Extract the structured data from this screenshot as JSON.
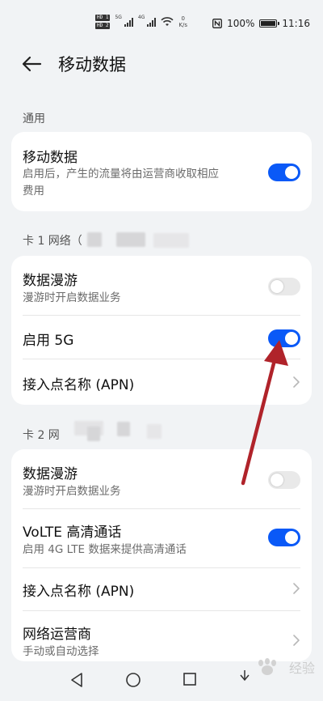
{
  "status_bar": {
    "sim1_label": "HD 1",
    "sim2_label": "HD 2",
    "net_type": "5G",
    "net_type2": "4G",
    "speed_value": "0",
    "speed_unit": "K/s",
    "battery_text": "100%",
    "battery_level": 1.0,
    "time": "11:16"
  },
  "header": {
    "title": "移动数据"
  },
  "general": {
    "section_label": "通用",
    "mobile_data": {
      "title": "移动数据",
      "subtitle_line1": "启用后，产生的流量将由运营商收取相应",
      "subtitle_line2": "费用",
      "enabled": true
    }
  },
  "sim1": {
    "section_label": "卡 1 网络（",
    "roaming": {
      "title": "数据漫游",
      "subtitle": "漫游时开启数据业务",
      "enabled": false
    },
    "enable_5g": {
      "title": "启用 5G",
      "enabled": true
    },
    "apn": {
      "title": "接入点名称 (APN)"
    }
  },
  "sim2": {
    "section_label": "卡 2 网",
    "roaming": {
      "title": "数据漫游",
      "subtitle": "漫游时开启数据业务",
      "enabled": false
    },
    "volte": {
      "title": "VoLTE 高清通话",
      "subtitle": "启用 4G LTE 数据来提供高清通话",
      "enabled": true
    },
    "apn": {
      "title": "接入点名称 (APN)"
    },
    "operator": {
      "title": "网络运营商",
      "subtitle": "手动或自动选择"
    }
  },
  "colors": {
    "accent": "#0a59f7",
    "annotation_arrow": "#b0232a"
  },
  "watermark": {
    "text": "经验"
  }
}
